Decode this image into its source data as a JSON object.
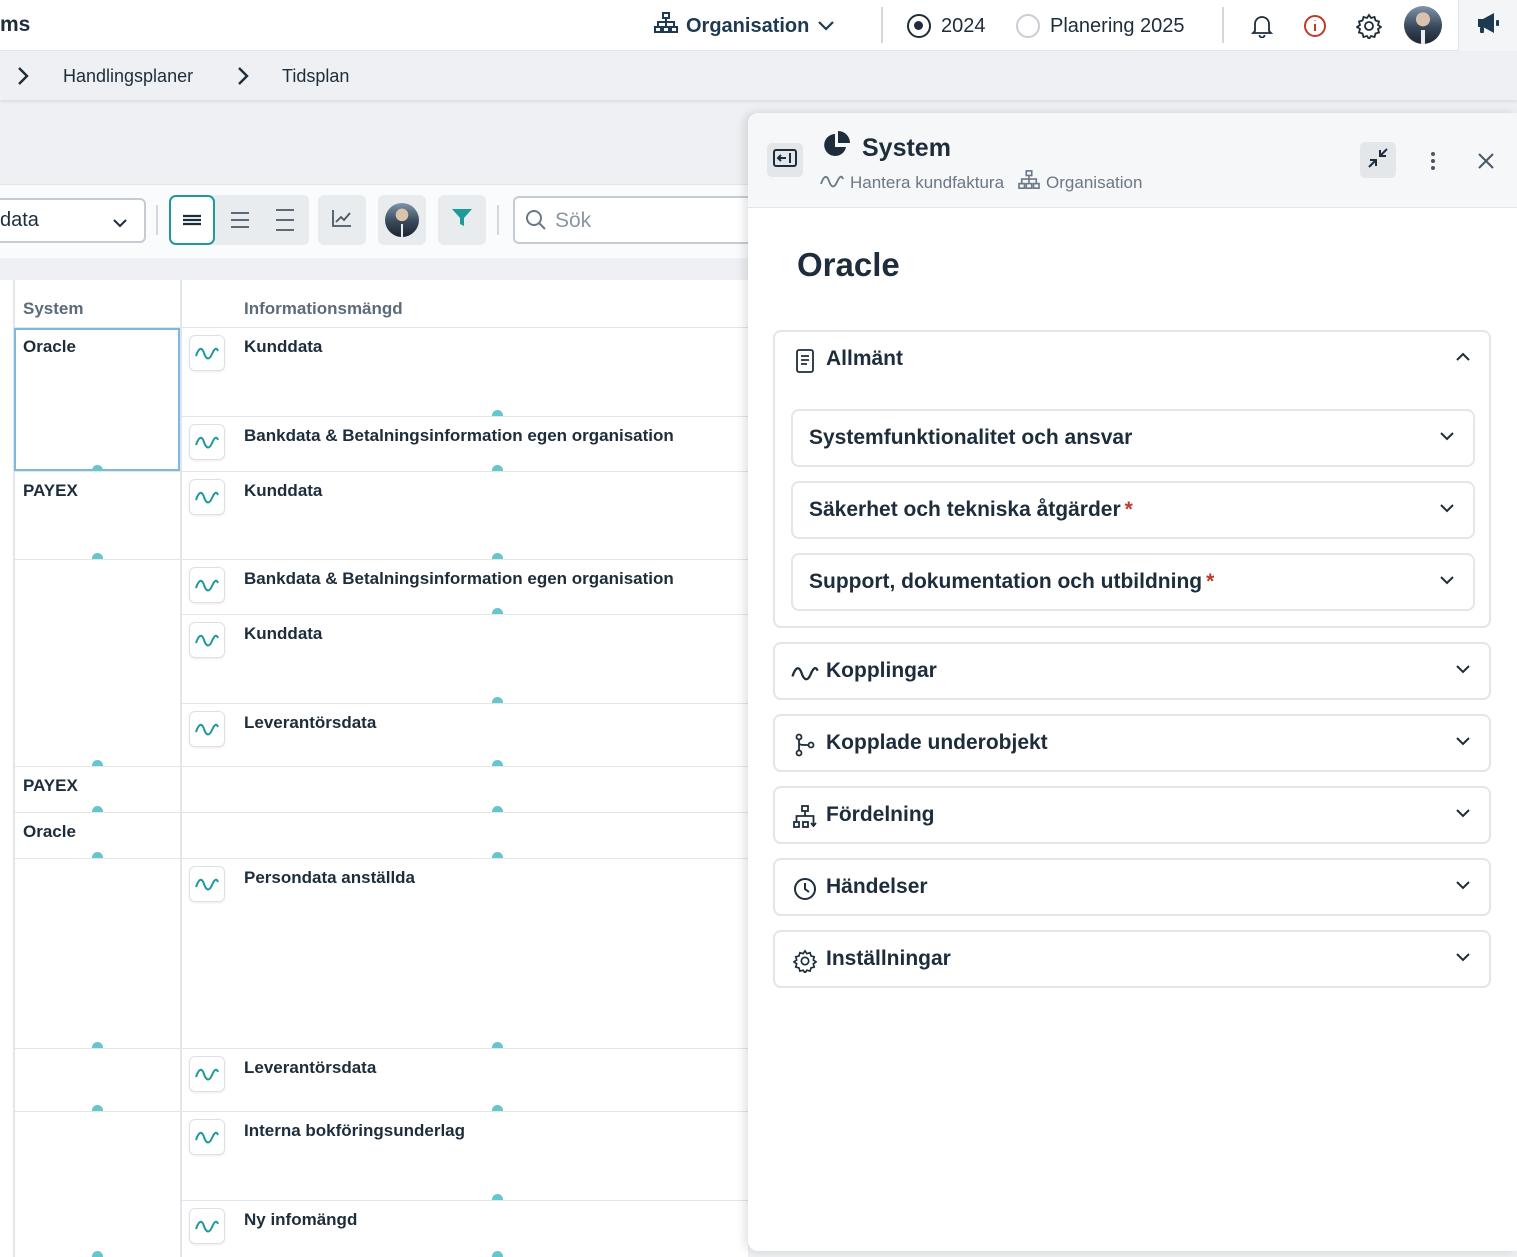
{
  "topbar": {
    "app_name": "ms",
    "org_label": "Organisation",
    "year_current": "2024",
    "year_planning": "Planering 2025",
    "icons": [
      "org-chart-icon",
      "chevron-down-icon",
      "bell-icon",
      "info-icon",
      "gear-icon",
      "avatar",
      "megaphone-icon"
    ]
  },
  "breadcrumb": {
    "items": [
      "Handlingsplaner",
      "Tidsplan"
    ]
  },
  "toolbar": {
    "select_value": "data",
    "search_placeholder": "Sök"
  },
  "table": {
    "headers": {
      "system": "System",
      "info": "Informationsmängd"
    },
    "systems": [
      "Oracle",
      "PAYEX",
      "PAYEX",
      "Oracle"
    ],
    "info_rows": [
      "Kunddata",
      "Bankdata & Betalningsinformation egen organisation",
      "Kunddata",
      "Bankdata & Betalningsinformation egen organisation",
      "Kunddata",
      "Leverantörsdata",
      "Persondata anställda",
      "Leverantörsdata",
      "Interna bokföringsunderlag",
      "Ny infomängd"
    ]
  },
  "panel": {
    "type_label": "System",
    "sub_process": "Hantera kundfaktura",
    "sub_org": "Organisation",
    "object_title": "Oracle",
    "sections": {
      "general": "Allmänt",
      "sub1": "Systemfunktionalitet och ansvar",
      "sub2": "Säkerhet och tekniska åtgärder",
      "sub3": "Support, dokumentation och utbildning",
      "required_mark": "*",
      "links": "Kopplingar",
      "children": "Kopplade underobjekt",
      "distribution": "Fördelning",
      "events": "Händelser",
      "settings": "Inställningar"
    }
  },
  "colors": {
    "accent": "#1f9a9a",
    "text": "#1e2d3b",
    "danger": "#c0392b"
  }
}
